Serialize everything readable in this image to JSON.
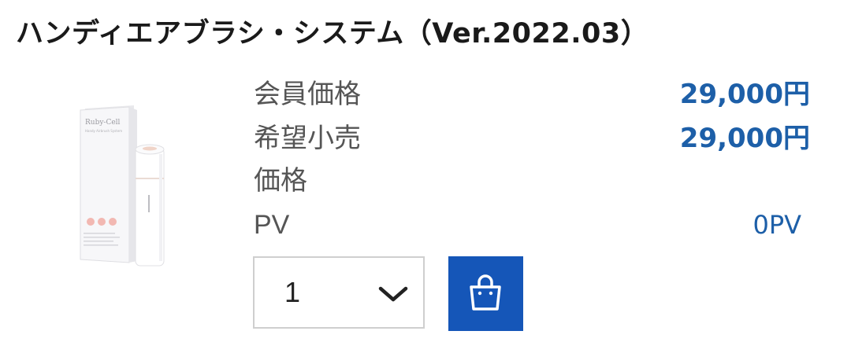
{
  "product": {
    "title": "ハンディエアブラシ・システム（Ver.2022.03）",
    "image_brand": "Ruby-Cell",
    "image_subtitle": "Handy Airbrush System"
  },
  "pricing": {
    "member_price_label": "会員価格",
    "member_price_value": "29,000円",
    "retail_price_label_line1": "希望小売",
    "retail_price_label_line2": "価格",
    "retail_price_value": "29,000円",
    "pv_label": "PV",
    "pv_value": "0PV"
  },
  "quantity": {
    "selected": "1"
  },
  "cart": {
    "icon": "shopping-bag-icon",
    "color": "#1556b8"
  },
  "colors": {
    "price_blue": "#1d5fa8",
    "button_blue": "#1556b8",
    "image_dots": "#f2b8b2"
  }
}
